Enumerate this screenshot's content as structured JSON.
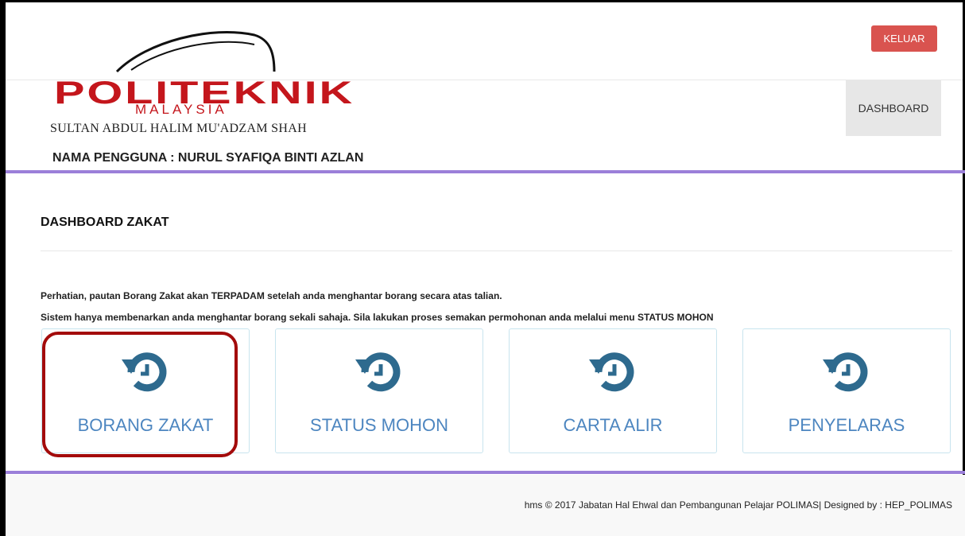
{
  "brand": {
    "logo_text": "POLITEKNIK",
    "logo_sub": "MALAYSIA",
    "institution": "SULTAN ABDUL HALIM MU'ADZAM SHAH"
  },
  "header": {
    "logout_label": "KELUAR",
    "nav_dashboard": "DASHBOARD",
    "username_line": "NAMA PENGGUNA : NURUL SYAFIQA BINTI AZLAN"
  },
  "main": {
    "title": "DASHBOARD ZAKAT",
    "notice_1": "Perhatian, pautan Borang Zakat akan TERPADAM setelah anda menghantar borang secara atas talian.",
    "notice_2": "Sistem hanya membenarkan anda menghantar borang sekali sahaja. Sila lakukan proses semakan permohonan anda melalui menu STATUS MOHON",
    "tiles": [
      {
        "label": "BORANG ZAKAT",
        "icon": "history-icon"
      },
      {
        "label": "STATUS MOHON",
        "icon": "history-icon"
      },
      {
        "label": "CARTA ALIR",
        "icon": "history-icon"
      },
      {
        "label": "PENYELARAS",
        "icon": "history-icon"
      }
    ]
  },
  "footer": {
    "text": "hms © 2017 Jabatan Hal Ehwal dan Pembangunan Pelajar POLIMAS| Designed by : HEP_POLIMAS"
  },
  "colors": {
    "accent_purple": "#9b7fd9",
    "logout_red": "#d9534f",
    "tile_text_blue": "#4d86c0",
    "icon_blue": "#2e6a8e",
    "highlight_red": "#a30b0b",
    "logo_red": "#c4161c"
  }
}
